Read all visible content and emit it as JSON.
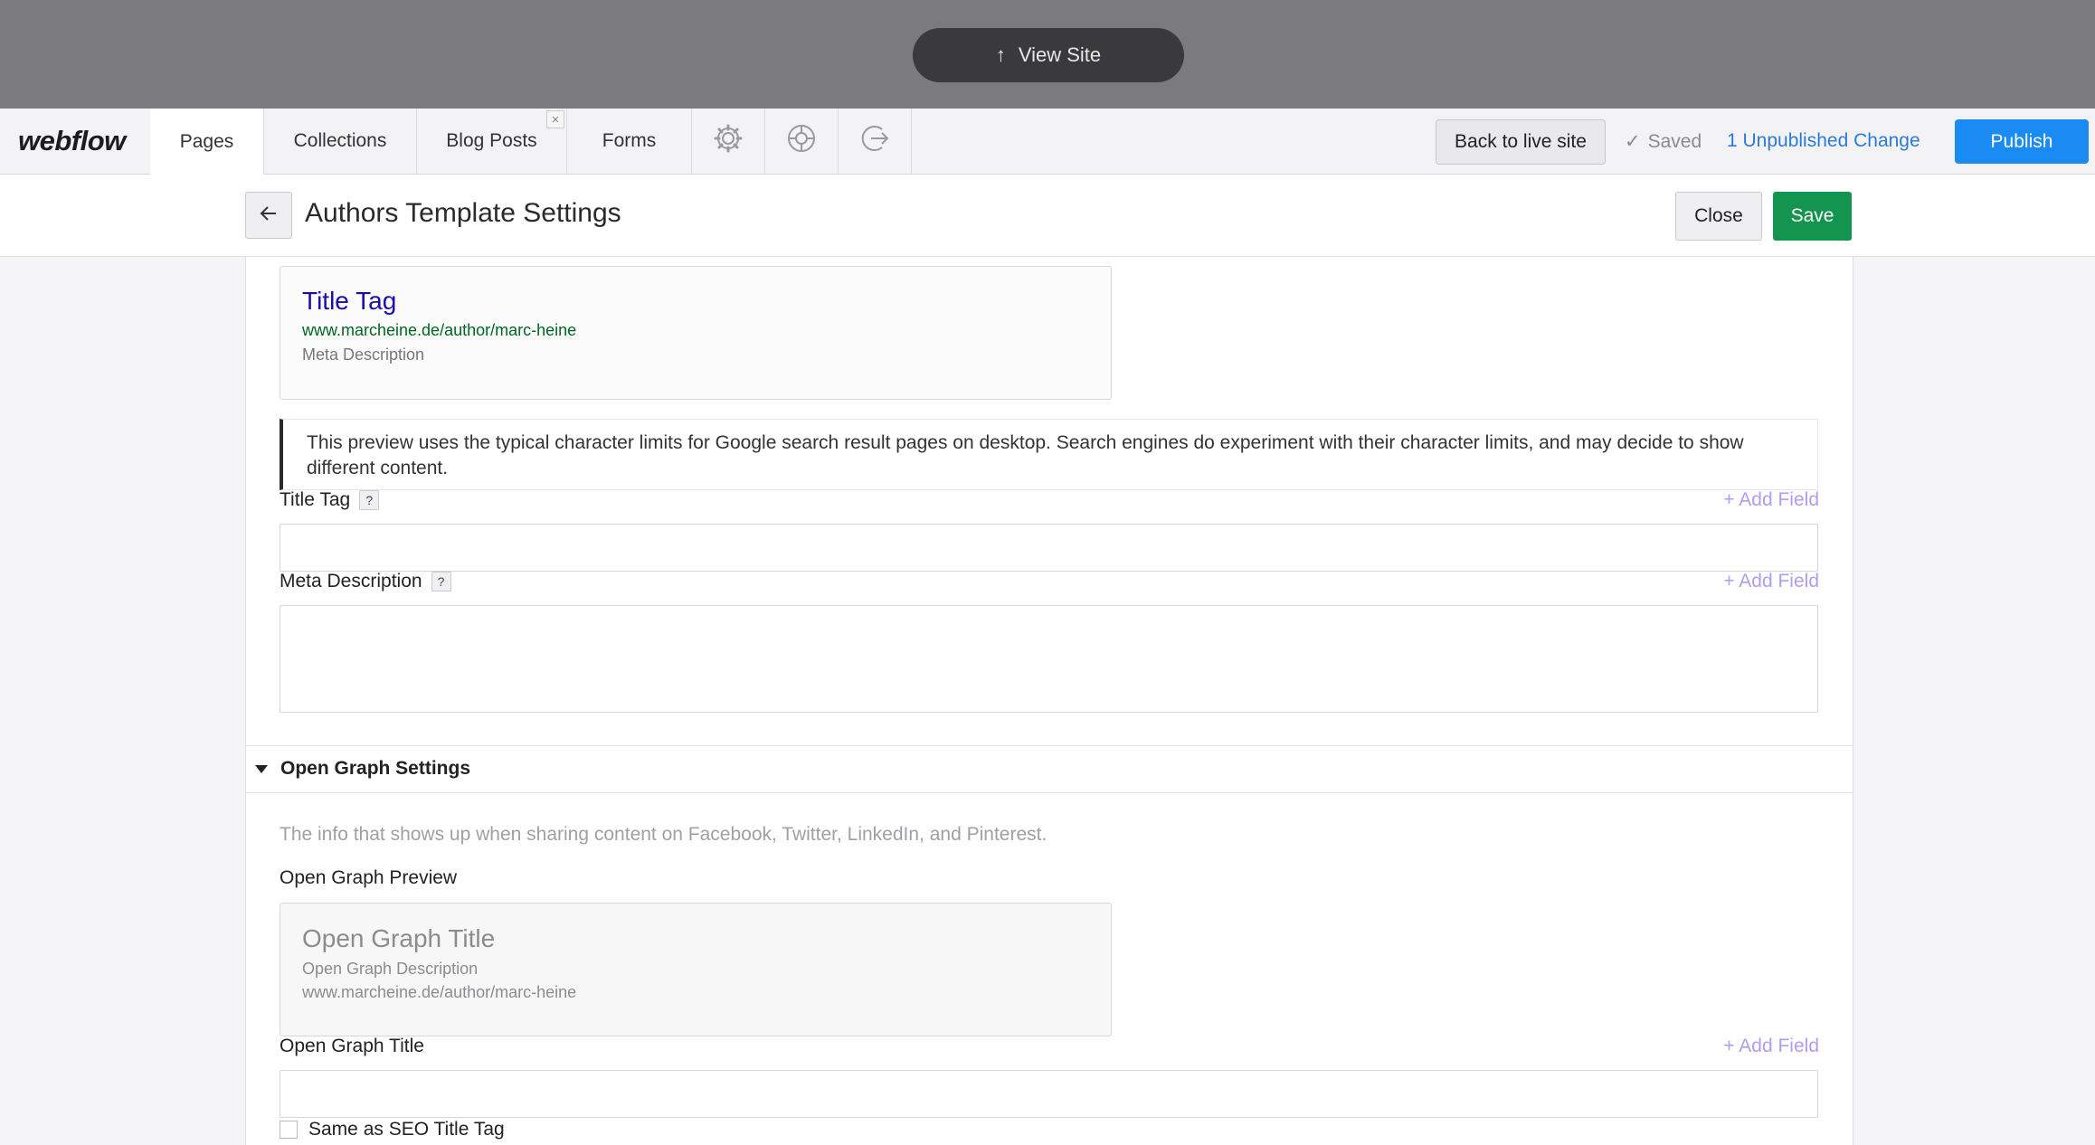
{
  "topbar": {
    "view_site_label": "View Site"
  },
  "nav": {
    "logo": "webflow",
    "tabs": [
      {
        "label": "Pages"
      },
      {
        "label": "Collections"
      },
      {
        "label": "Blog Posts"
      },
      {
        "label": "Forms"
      }
    ],
    "icons": [
      "gear-icon",
      "help-circle-icon",
      "share-icon"
    ],
    "back_to_live_label": "Back to live site",
    "saved_label": "Saved",
    "unpublished_label": "1 Unpublished Change",
    "publish_label": "Publish"
  },
  "header": {
    "title": "Authors Template Settings",
    "close_label": "Close",
    "save_label": "Save"
  },
  "seo": {
    "preview_title": "Title Tag",
    "preview_url": "www.marcheine.de/author/marc-heine",
    "preview_description": "Meta Description",
    "notice": "This preview uses the typical character limits for Google search result pages on desktop. Search engines do experiment with their character limits, and may decide to show different content.",
    "title_tag_label": "Title Tag",
    "meta_description_label": "Meta Description",
    "add_field_label": "+ Add Field",
    "help_label": "?"
  },
  "open_graph": {
    "section_title": "Open Graph Settings",
    "info": "The info that shows up when sharing content on Facebook, Twitter, LinkedIn, and Pinterest.",
    "preview_label": "Open Graph Preview",
    "preview_title": "Open Graph Title",
    "preview_description": "Open Graph Description",
    "preview_url": "www.marcheine.de/author/marc-heine",
    "title_label": "Open Graph Title",
    "add_field_label": "+ Add Field",
    "same_as_label": "Same as SEO Title Tag"
  },
  "colors": {
    "publish": "#1a8bf2",
    "save": "#14954f",
    "link": "#2b7bd6",
    "add_field": "#b09cf0"
  }
}
